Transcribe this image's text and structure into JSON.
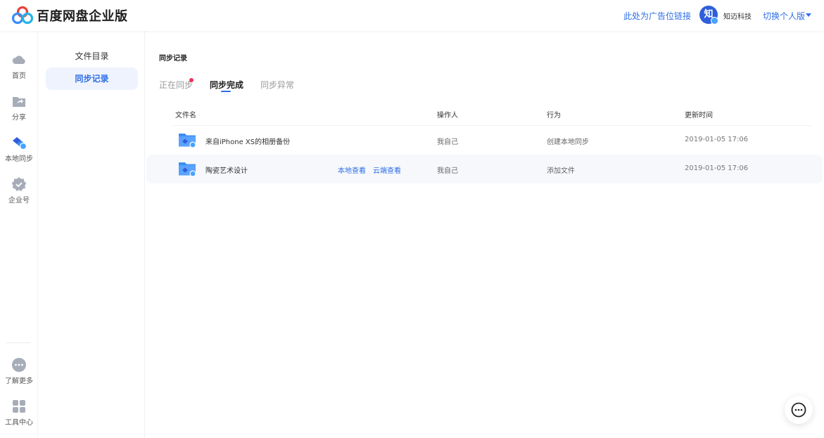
{
  "header": {
    "brand": "百度网盘企业版",
    "ad_link": "此处为广告位链接",
    "avatar_char": "知",
    "company": "知迈科技",
    "switch_version": "切换个人版"
  },
  "rail": {
    "items": [
      {
        "label": "首页",
        "icon": "cloud-icon"
      },
      {
        "label": "分享",
        "icon": "share-folder-icon"
      },
      {
        "label": "本地同步",
        "icon": "sync-icon"
      },
      {
        "label": "企业号",
        "icon": "enterprise-badge-icon"
      }
    ],
    "bottom": [
      {
        "label": "了解更多",
        "icon": "more-icon"
      },
      {
        "label": "工具中心",
        "icon": "grid-icon"
      }
    ]
  },
  "subnav": {
    "items": [
      {
        "label": "文件目录",
        "active": false
      },
      {
        "label": "同步记录",
        "active": true
      }
    ]
  },
  "main": {
    "title": "同步记录",
    "tabs": [
      {
        "label": "正在同步",
        "active": false,
        "has_dot": true
      },
      {
        "label": "同步完成",
        "active": true
      },
      {
        "label": "同步异常",
        "active": false
      }
    ],
    "columns": [
      "文件名",
      "操作人",
      "行为",
      "更新时间"
    ],
    "rows": [
      {
        "name": "来自iPhone XS的相册备份",
        "operator": "我自己",
        "action": "创建本地同步",
        "time": "2019-01-05 17:06"
      },
      {
        "name": "陶瓷艺术设计",
        "operator": "我自己",
        "action": "添加文件",
        "time": "2019-01-05 17:06",
        "local_view": "本地查看",
        "cloud_view": "云端查看"
      }
    ]
  },
  "colors": {
    "accent": "#2e6ee6",
    "notification_dot": "#f0325a",
    "active_bg": "#eef3fd"
  }
}
